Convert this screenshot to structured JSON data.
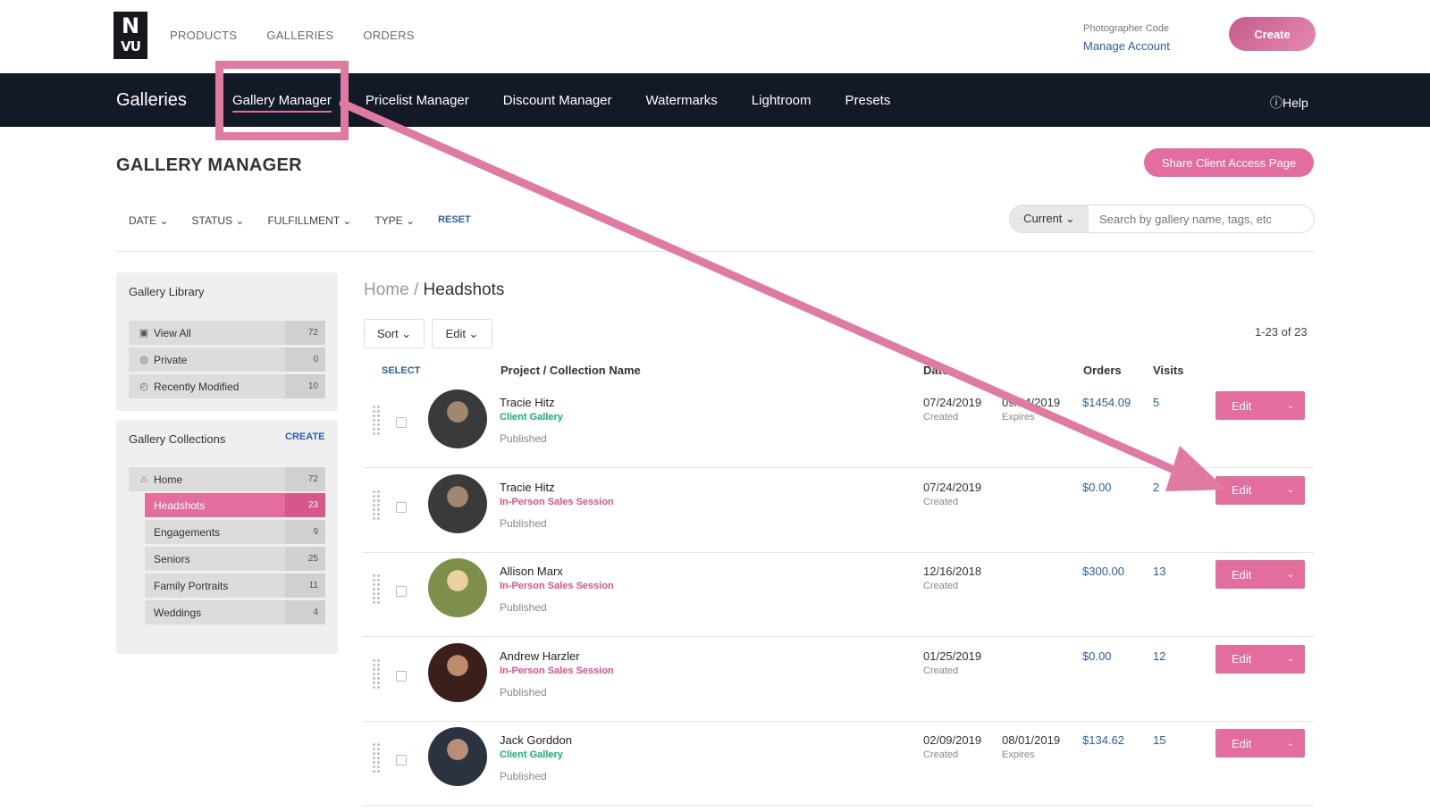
{
  "logo": {
    "line1": "N",
    "line2": "VU"
  },
  "topnav": [
    "PRODUCTS",
    "GALLERIES",
    "ORDERS"
  ],
  "account": {
    "code_label": "Photographer Code",
    "manage_label": "Manage Account"
  },
  "create_label": "Create",
  "subnav": {
    "title": "Galleries",
    "items": [
      "Gallery Manager",
      "Pricelist Manager",
      "Discount Manager",
      "Watermarks",
      "Lightroom",
      "Presets"
    ],
    "help": "ⓘHelp"
  },
  "page": {
    "title": "GALLERY MANAGER",
    "share_label": "Share Client Access Page",
    "filters": [
      "DATE ⌄",
      "STATUS ⌄",
      "FULFILLMENT ⌄",
      "TYPE ⌄"
    ],
    "reset": "RESET",
    "scope": "Current ⌄",
    "search_placeholder": "Search by gallery name, tags, etc"
  },
  "library": {
    "title": "Gallery Library",
    "items": [
      {
        "icon": "image-icon",
        "glyph": "▣",
        "label": "View All",
        "count": "72"
      },
      {
        "icon": "eye-slash-icon",
        "glyph": "◎",
        "label": "Private",
        "count": "0"
      },
      {
        "icon": "clock-icon",
        "glyph": "◴",
        "label": "Recently Modified",
        "count": "10"
      }
    ]
  },
  "collections": {
    "title": "Gallery Collections",
    "create": "CREATE",
    "home": {
      "label": "Home",
      "count": "72"
    },
    "items": [
      {
        "label": "Headshots",
        "count": "23"
      },
      {
        "label": "Engagements",
        "count": "9"
      },
      {
        "label": "Seniors",
        "count": "25"
      },
      {
        "label": "Family Portraits",
        "count": "11"
      },
      {
        "label": "Weddings",
        "count": "4"
      }
    ]
  },
  "main": {
    "breadcrumb_home": "Home",
    "breadcrumb_sep": " / ",
    "breadcrumb_current": "Headshots",
    "sort_label": "Sort ⌄",
    "edit_label": "Edit ⌄",
    "page_count": "1-23 of 23",
    "headers": {
      "select": "SELECT",
      "name": "Project / Collection Name",
      "date": "Date",
      "orders": "Orders",
      "visits": "Visits"
    },
    "rows": [
      {
        "name": "Tracie Hitz",
        "type": "Client Gallery",
        "type_color": "green",
        "status": "Published",
        "date1": "07/24/2019",
        "date1_label": "Created",
        "date2": "09/24/2019",
        "date2_label": "Expires",
        "orders": "$1454.09",
        "visits": "5",
        "edit": "Edit",
        "avatar": [
          "#3a3a3a",
          "#a08770"
        ]
      },
      {
        "name": "Tracie Hitz",
        "type": "In-Person Sales Session",
        "type_color": "pink",
        "status": "Published",
        "date1": "07/24/2019",
        "date1_label": "Created",
        "date2": "",
        "date2_label": "",
        "orders": "$0.00",
        "visits": "2",
        "edit": "Edit",
        "avatar": [
          "#3a3a3a",
          "#a08770"
        ]
      },
      {
        "name": "Allison Marx",
        "type": "In-Person Sales Session",
        "type_color": "pink",
        "status": "Published",
        "date1": "12/16/2018",
        "date1_label": "Created",
        "date2": "",
        "date2_label": "",
        "orders": "$300.00",
        "visits": "13",
        "edit": "Edit",
        "avatar": [
          "#7d8f4a",
          "#e9d2a0"
        ]
      },
      {
        "name": "Andrew Harzler",
        "type": "In-Person Sales Session",
        "type_color": "pink",
        "status": "Published",
        "date1": "01/25/2019",
        "date1_label": "Created",
        "date2": "",
        "date2_label": "",
        "orders": "$0.00",
        "visits": "12",
        "edit": "Edit",
        "avatar": [
          "#3a1f1a",
          "#c08a6c"
        ]
      },
      {
        "name": "Jack Gorddon",
        "type": "Client Gallery",
        "type_color": "green",
        "status": "Published",
        "date1": "02/09/2019",
        "date1_label": "Created",
        "date2": "08/01/2019",
        "date2_label": "Expires",
        "orders": "$134.62",
        "visits": "15",
        "edit": "Edit",
        "avatar": [
          "#2c3340",
          "#b88f74"
        ]
      }
    ]
  },
  "colors": {
    "accent": "#e36e9d",
    "navy": "#121a28",
    "link": "#2a5db0",
    "green": "#17b07b"
  }
}
